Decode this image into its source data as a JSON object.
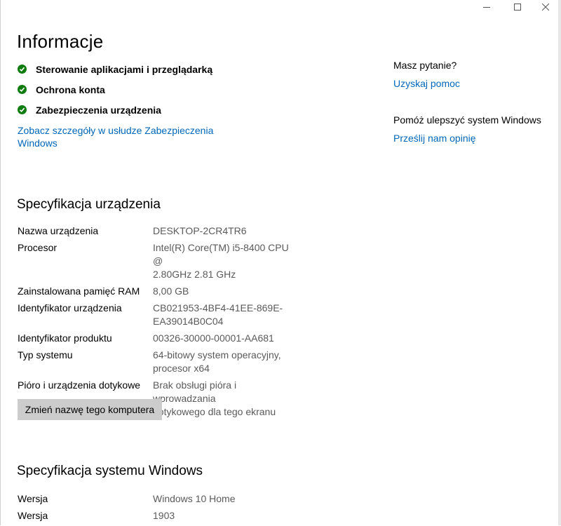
{
  "window": {
    "caption_buttons": [
      "minimize",
      "maximize",
      "close"
    ]
  },
  "page": {
    "title": "Informacje"
  },
  "security_status": {
    "items": [
      {
        "label": "Sterowanie aplikacjami i przeglądarką",
        "icon": "check-circle-icon",
        "color": "#107c10"
      },
      {
        "label": "Ochrona konta",
        "icon": "check-circle-icon",
        "color": "#107c10"
      },
      {
        "label": "Zabezpieczenia urządzenia",
        "icon": "check-circle-icon",
        "color": "#107c10"
      }
    ],
    "details_link": "Zobacz szczegóły w usłudze Zabezpieczenia Windows"
  },
  "aside": {
    "question_heading": "Masz pytanie?",
    "help_link": "Uzyskaj pomoc",
    "improve_heading": "Pomóż ulepszyć system Windows",
    "feedback_link": "Prześlij nam opinię"
  },
  "device_specs": {
    "title": "Specyfikacja urządzenia",
    "rows": [
      {
        "label": "Nazwa urządzenia",
        "value": "DESKTOP-2CR4TR6"
      },
      {
        "label": "Procesor",
        "value": "Intel(R) Core(TM) i5-8400 CPU @\n2.80GHz   2.81 GHz"
      },
      {
        "label": "Zainstalowana pamięć RAM",
        "value": "8,00 GB"
      },
      {
        "label": "Identyfikator urządzenia",
        "value": "CB021953-4BF4-41EE-869E-\nEA39014B0C04"
      },
      {
        "label": "Identyfikator produktu",
        "value": "00326-30000-00001-AA681"
      },
      {
        "label": "Typ systemu",
        "value": "64-bitowy system operacyjny,\nprocesor x64"
      },
      {
        "label": "Pióro i urządzenia dotykowe",
        "value": "Brak obsługi pióra i wprowadzania\ndotykowego dla tego ekranu"
      }
    ],
    "rename_button": "Zmień nazwę tego komputera"
  },
  "windows_specs": {
    "title": "Specyfikacja systemu Windows",
    "rows": [
      {
        "label": "Wersja",
        "value": "Windows 10 Home"
      },
      {
        "label": "Wersja",
        "value": "1903"
      }
    ]
  },
  "colors": {
    "accent_link": "#0067b8",
    "check_green": "#107c10",
    "value_gray": "#5a5a5a",
    "button_gray": "#cccccc"
  }
}
